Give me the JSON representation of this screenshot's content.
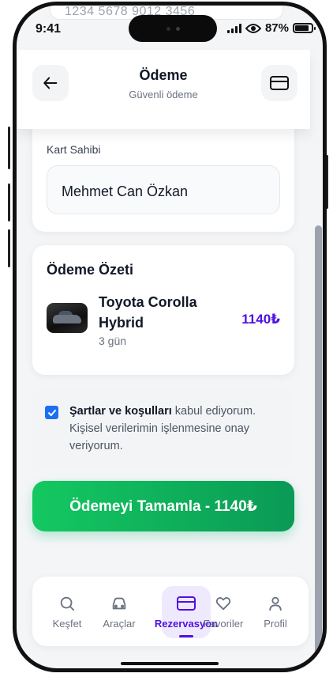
{
  "status_bar": {
    "time": "9:41",
    "battery": "87%"
  },
  "prev_field": {
    "card_number": "1234 5678 9012 3456"
  },
  "header": {
    "title": "Ödeme",
    "subtitle": "Güvenli ödeme"
  },
  "cardholder": {
    "label": "Kart Sahibi",
    "value": "Mehmet Can Özkan"
  },
  "summary": {
    "title": "Ödeme Özeti",
    "car_name": "Toyota Corolla Hybrid",
    "duration": "3 gün",
    "price": "1140₺"
  },
  "terms": {
    "checked": true,
    "bold": "Şartlar ve koşulları",
    "text": " kabul ediyorum. Kişisel verilerimin işlenmesine onay veriyorum."
  },
  "pay_button": {
    "label": "Ödemeyi Tamamla - 1140₺"
  },
  "tabbar": {
    "items": [
      {
        "label": "Keşfet",
        "icon": "search-icon"
      },
      {
        "label": "Araçlar",
        "icon": "car-icon"
      },
      {
        "label": "Rezervasyon",
        "icon": "card-icon",
        "active": true
      },
      {
        "label": "Favoriler",
        "icon": "heart-icon"
      },
      {
        "label": "Profil",
        "icon": "user-icon"
      }
    ]
  },
  "colors": {
    "accent": "#4f12e0",
    "success": "#10b461",
    "checkbox": "#1d6ff2"
  }
}
